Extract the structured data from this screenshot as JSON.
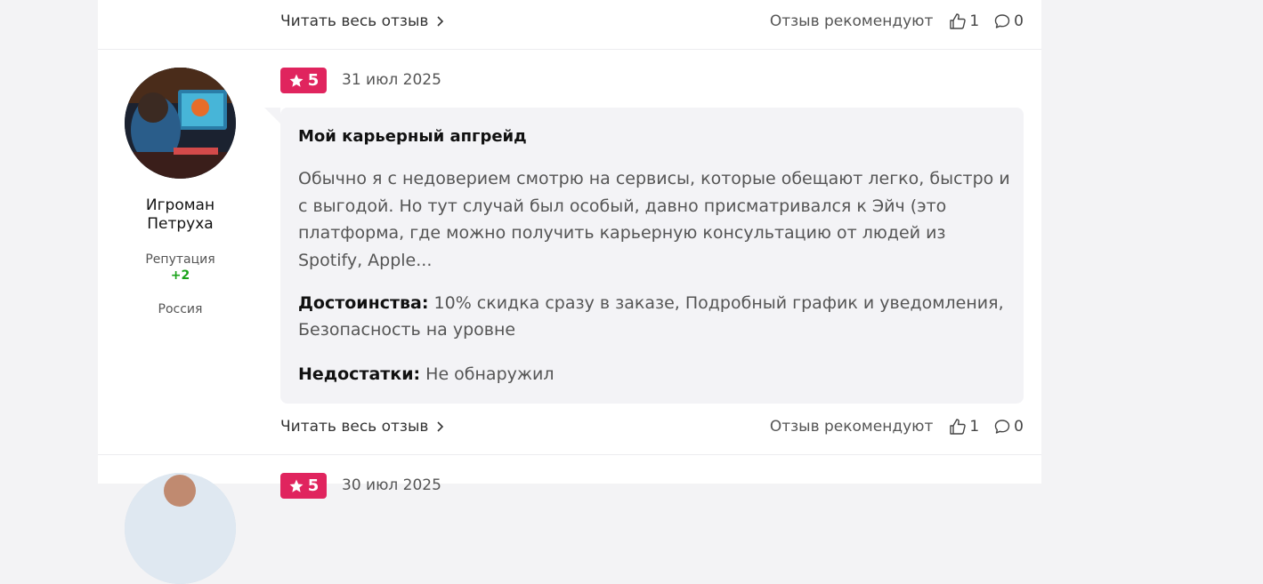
{
  "prev_review": {
    "read_more": "Читать весь отзыв",
    "recommend_label": "Отзыв рекомендуют",
    "likes": "1",
    "comments": "0"
  },
  "review": {
    "rating": "5",
    "date": "31 июл 2025",
    "author": {
      "name_line1": "Игроман",
      "name_line2": "Петруха",
      "reputation_label": "Репутация",
      "reputation_value": "+2",
      "country": "Россия"
    },
    "title": "Мой карьерный апгрейд",
    "text": "Обычно я с недоверием смотрю на сервисы, которые обещают легко, быстро и с выгодой. Но тут случай был особый, давно присматривался к Эйч (это платформа, где можно получить карьерную консультацию от людей из Spotify, Apple...",
    "pros_label": "Достоинства:",
    "pros": "10% скидка сразу в заказе, Подробный график и уведомления, Безопасность на уровне",
    "cons_label": "Недостатки:",
    "cons": "Не обнаружил",
    "read_more": "Читать весь отзыв",
    "recommend_label": "Отзыв рекомендуют",
    "likes": "1",
    "comments": "0"
  },
  "next_review": {
    "rating": "5",
    "date": "30 июл 2025"
  },
  "colors": {
    "rating_badge": "#e0245e",
    "reputation_positive": "#1aa31a",
    "bubble_bg": "#f3f3f6"
  }
}
